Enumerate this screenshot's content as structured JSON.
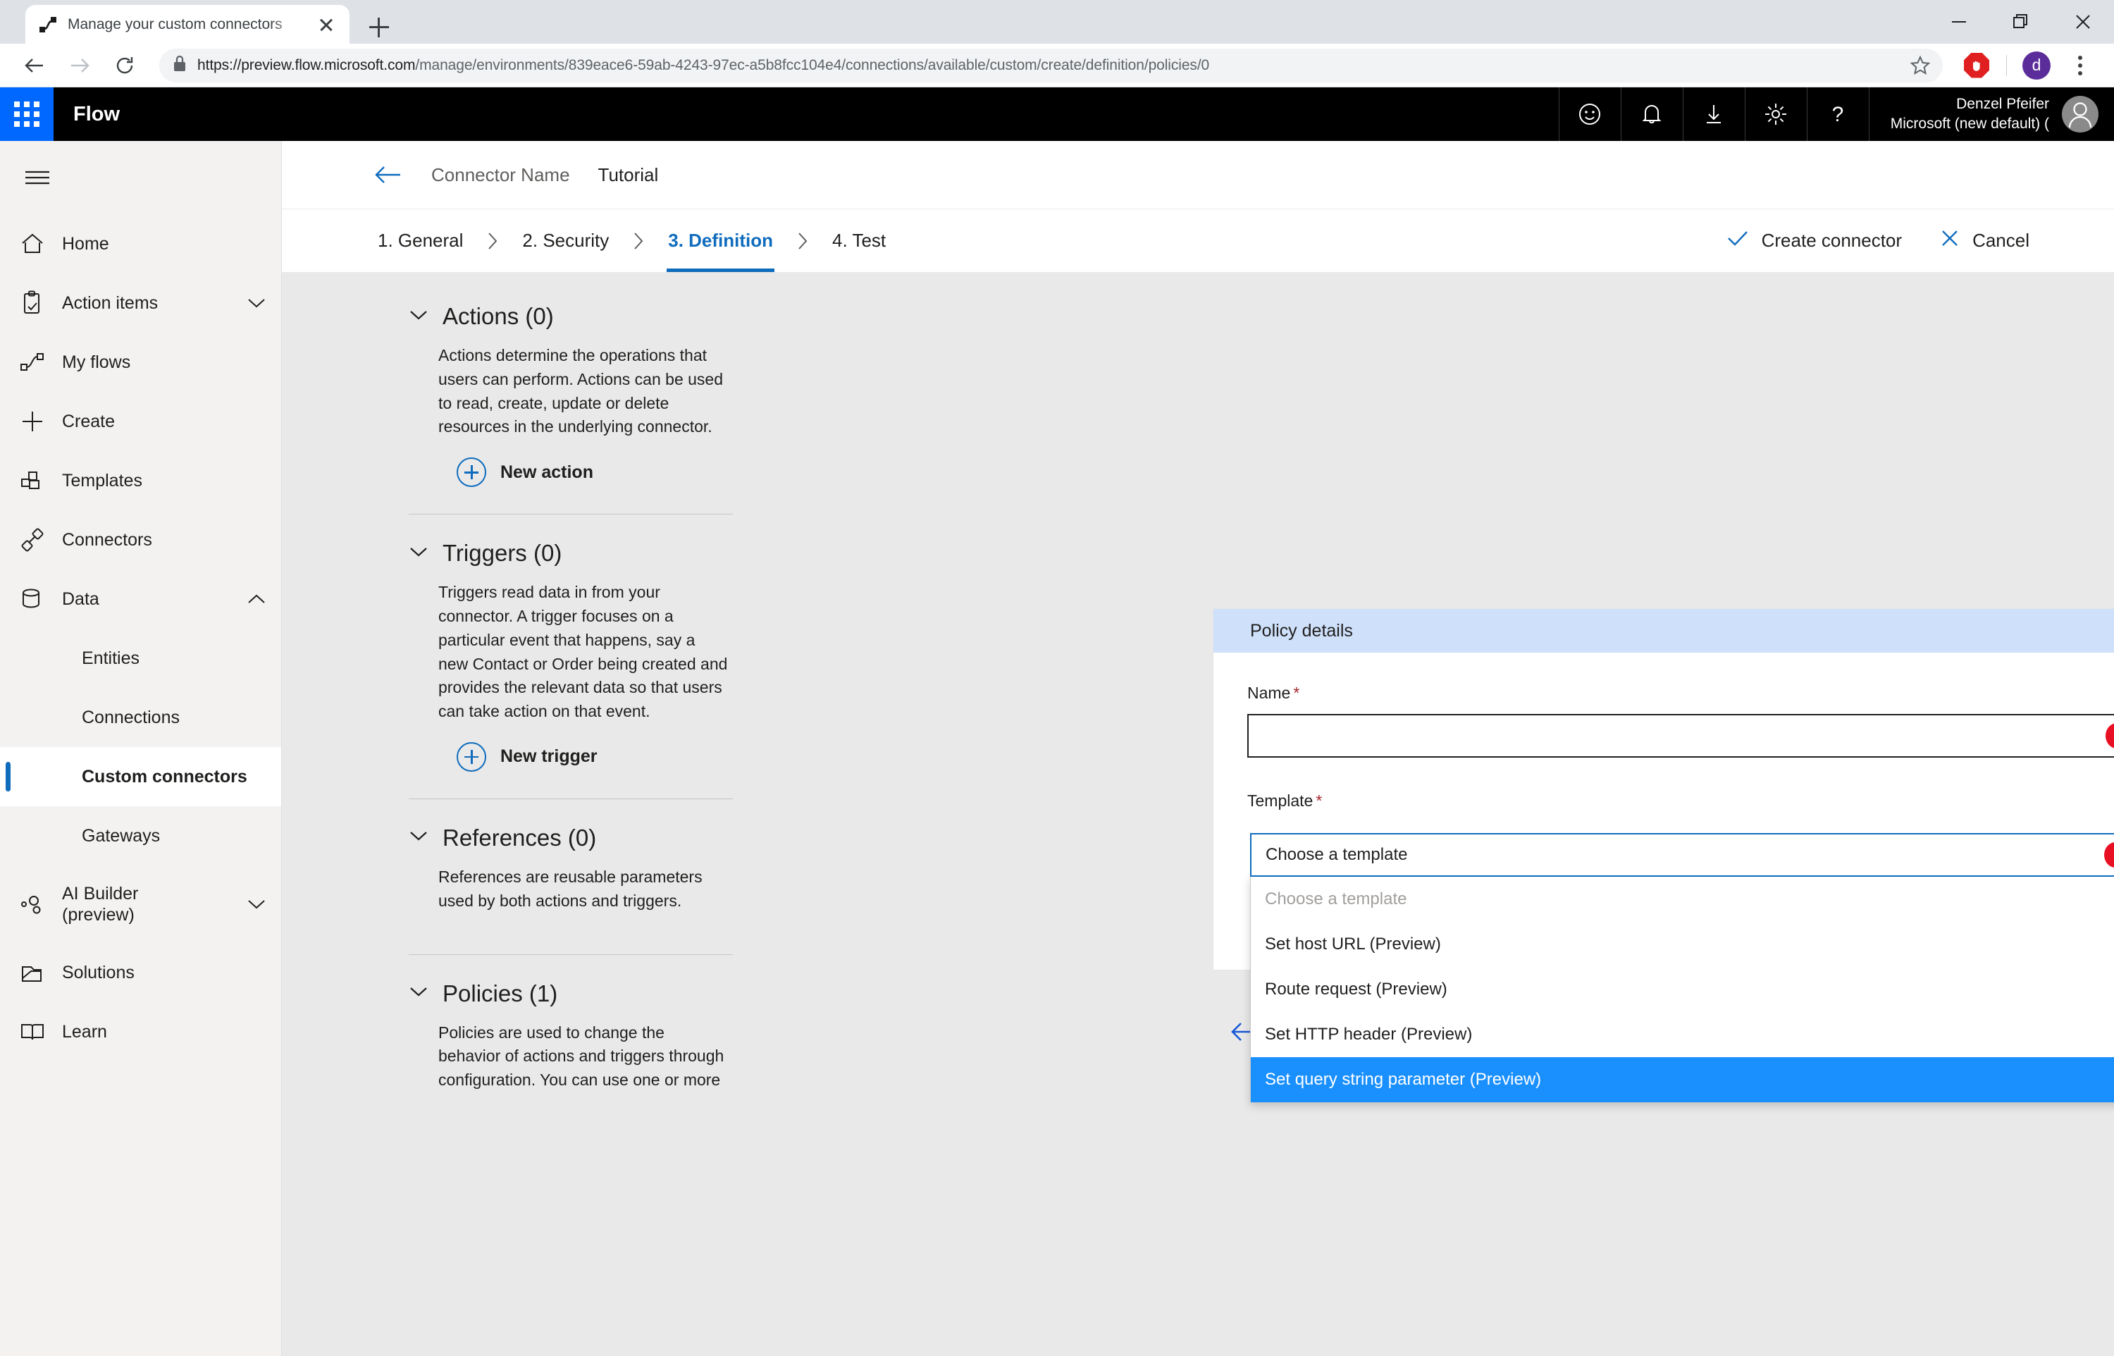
{
  "browser": {
    "tab": {
      "title": "Manage your custom connectors",
      "favicon_icon": "flow-connector-icon",
      "close_icon": "close-icon"
    },
    "new_tab_icon": "plus-icon",
    "window_controls": {
      "minimize_icon": "minimize-icon",
      "maximize_icon": "restore-icon",
      "close_icon": "window-close-icon"
    },
    "nav": {
      "back_icon": "arrow-left-icon",
      "forward_icon": "arrow-right-icon",
      "reload_icon": "reload-icon"
    },
    "url": {
      "lock_icon": "lock-icon",
      "scheme_host": "https://preview.flow.microsoft.com",
      "path": "/manage/environments/839eace6-59ab-4243-97ec-a5b8fcc104e4/connections/available/custom/create/definition/policies/0",
      "star_icon": "bookmark-star-icon"
    },
    "toolbar_right": {
      "adblock_icon": "adblock-hand-icon",
      "profile_initial": "d",
      "menu_icon": "kebab-menu-icon"
    }
  },
  "suitebar": {
    "waffle_icon": "app-launcher-waffle-icon",
    "brand": "Flow",
    "accent_blue": "#0067ff",
    "icons": [
      {
        "name": "feedback-smiley-icon"
      },
      {
        "name": "notifications-bell-icon"
      },
      {
        "name": "download-icon"
      },
      {
        "name": "settings-gear-icon"
      },
      {
        "name": "help-question-icon"
      }
    ],
    "user": {
      "name": "Denzel Pfeifer",
      "org": "Microsoft (new default) (",
      "avatar_icon": "user-avatar-icon"
    }
  },
  "sidebar": {
    "hamburger_icon": "hamburger-menu-icon",
    "items": [
      {
        "label": "Home",
        "icon": "home-icon",
        "type": "top"
      },
      {
        "label": "Action items",
        "icon": "clipboard-check-icon",
        "type": "top",
        "chevron": "chevron-down-icon"
      },
      {
        "label": "My flows",
        "icon": "flow-icon",
        "type": "top"
      },
      {
        "label": "Create",
        "icon": "plus-icon",
        "type": "top"
      },
      {
        "label": "Templates",
        "icon": "templates-icon",
        "type": "top"
      },
      {
        "label": "Connectors",
        "icon": "connectors-plug-icon",
        "type": "top"
      },
      {
        "label": "Data",
        "icon": "database-icon",
        "type": "top",
        "chevron": "chevron-up-icon"
      },
      {
        "label": "Entities",
        "type": "sub"
      },
      {
        "label": "Connections",
        "type": "sub"
      },
      {
        "label": "Custom connectors",
        "type": "sub",
        "active": true
      },
      {
        "label": "Gateways",
        "type": "sub"
      },
      {
        "label": "AI Builder (preview)",
        "icon": "ai-builder-icon",
        "type": "top",
        "chevron": "chevron-down-icon",
        "two_line": true
      },
      {
        "label": "Solutions",
        "icon": "solutions-icon",
        "type": "top"
      },
      {
        "label": "Learn",
        "icon": "book-icon",
        "type": "top"
      }
    ]
  },
  "breadcrumb": {
    "back_icon": "arrow-left-icon",
    "connector_name": "Connector Name",
    "page": "Tutorial"
  },
  "steps": {
    "separator_icon": "chevron-right-icon",
    "items": [
      {
        "label": "1. General",
        "active": false
      },
      {
        "label": "2. Security",
        "active": false
      },
      {
        "label": "3. Definition",
        "active": true
      },
      {
        "label": "4. Test",
        "active": false
      }
    ],
    "accent": "#0f6cbd"
  },
  "commands": {
    "create": {
      "label": "Create connector",
      "icon": "checkmark-icon"
    },
    "cancel": {
      "label": "Cancel",
      "icon": "close-x-icon"
    }
  },
  "definition": {
    "sections": [
      {
        "title": "Actions (0)",
        "chevron": "chevron-down-icon",
        "body": "Actions determine the operations that users can perform. Actions can be used to read, create, update or delete resources in the underlying connector.",
        "button": {
          "label": "New action",
          "icon": "plus-circle-icon"
        }
      },
      {
        "title": "Triggers (0)",
        "chevron": "chevron-down-icon",
        "body": "Triggers read data in from your connector. A trigger focuses on a particular event that happens, say a new Contact or Order being created and provides the relevant data so that users can take action on that event.",
        "button": {
          "label": "New trigger",
          "icon": "plus-circle-icon"
        }
      },
      {
        "title": "References (0)",
        "chevron": "chevron-down-icon",
        "body": "References are reusable parameters used by both actions and triggers.",
        "button": null
      },
      {
        "title": "Policies (1)",
        "chevron": "chevron-down-icon",
        "body": "Policies are used to change the behavior of actions and triggers through configuration. You can use one or more",
        "button": null
      }
    ]
  },
  "policy_panel": {
    "header": "Policy details",
    "header_bg": "#cfe0fb",
    "name_field": {
      "label": "Name",
      "required_marker": "*",
      "value": "",
      "placeholder": "",
      "error_icon": "error-exclamation-icon"
    },
    "template_field": {
      "label": "Template",
      "required_marker": "*",
      "value": "Choose a template",
      "error_icon": "error-exclamation-icon",
      "options": [
        {
          "label": "Choose a template",
          "placeholder": true,
          "selected": false
        },
        {
          "label": "Set host URL (Preview)",
          "placeholder": false,
          "selected": false
        },
        {
          "label": "Route request (Preview)",
          "placeholder": false,
          "selected": false
        },
        {
          "label": "Set HTTP header (Preview)",
          "placeholder": false,
          "selected": false
        },
        {
          "label": "Set query string parameter (Preview)",
          "placeholder": false,
          "selected": true
        }
      ],
      "highlight_color": "#1a90ff"
    }
  },
  "wizard_nav": {
    "prev_icon": "arrow-left-icon",
    "next_icon": "arrow-right-icon"
  }
}
